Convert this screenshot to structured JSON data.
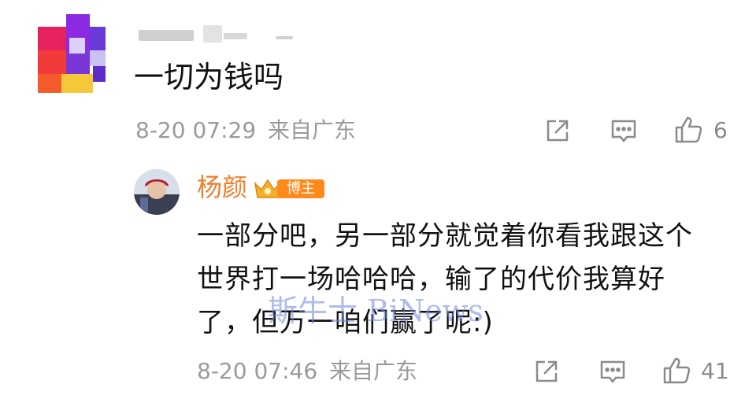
{
  "comment": {
    "text": "一切为钱吗",
    "time": "8-20 07:29",
    "location": "来自广东",
    "likes": "6",
    "icons": [
      "share-icon",
      "reply-icon",
      "like-icon"
    ]
  },
  "reply": {
    "author": "杨颜",
    "badge": "博主",
    "lines": [
      "一部分吧，另一部分就觉着你看我跟这个",
      "世界打一场哈哈哈，输了的代价我算好",
      "了，但万一咱们赢了呢:)"
    ],
    "time": "8-20 07:46",
    "location": "来自广东",
    "likes": "41",
    "icons": [
      "share-icon",
      "reply-icon",
      "like-icon"
    ]
  },
  "watermark": "斯牛士 BiNews",
  "colors": {
    "author_orange": "#f27d2b",
    "badge_orange": "#ff8a1c",
    "meta_gray": "#9a9a9a",
    "text": "#111111"
  }
}
